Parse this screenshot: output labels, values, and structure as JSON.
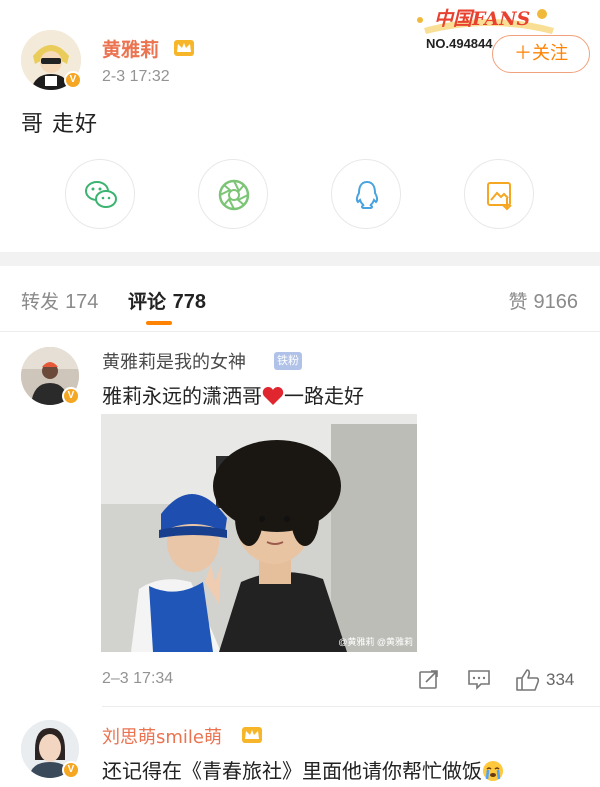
{
  "post": {
    "author": "黄雅莉",
    "time": "2-3 17:32",
    "text": "哥 走好",
    "verified_badge": "V",
    "fans_badge": {
      "title": "中国FANS",
      "number": "NO.494844"
    },
    "follow_label": "＋关注",
    "share_icons": [
      "wechat-icon",
      "moments-icon",
      "qq-icon",
      "save-image-icon"
    ]
  },
  "tabs": {
    "repost": {
      "label": "转发",
      "count": "174"
    },
    "comments": {
      "label": "评论",
      "count": "778"
    },
    "likes": {
      "label": "赞",
      "count": "9166"
    }
  },
  "comments": [
    {
      "author": "黄雅莉是我的女神",
      "fan_tag": "铁粉",
      "text_before": "雅莉永远的潇洒哥",
      "text_after": "一路走好",
      "emoji": "heart",
      "image_watermark": "@黄雅莉 @黄雅莉",
      "time": "2–3 17:34",
      "like_count": "334"
    },
    {
      "author": "刘思萌smile萌",
      "text": "还记得在《青春旅社》里面他请你帮忙做饭",
      "emoji": "crying-face"
    }
  ],
  "colors": {
    "accent": "#ff8200",
    "author_orange": "#eb7350",
    "muted": "#939393",
    "verified": "#f5a623"
  }
}
